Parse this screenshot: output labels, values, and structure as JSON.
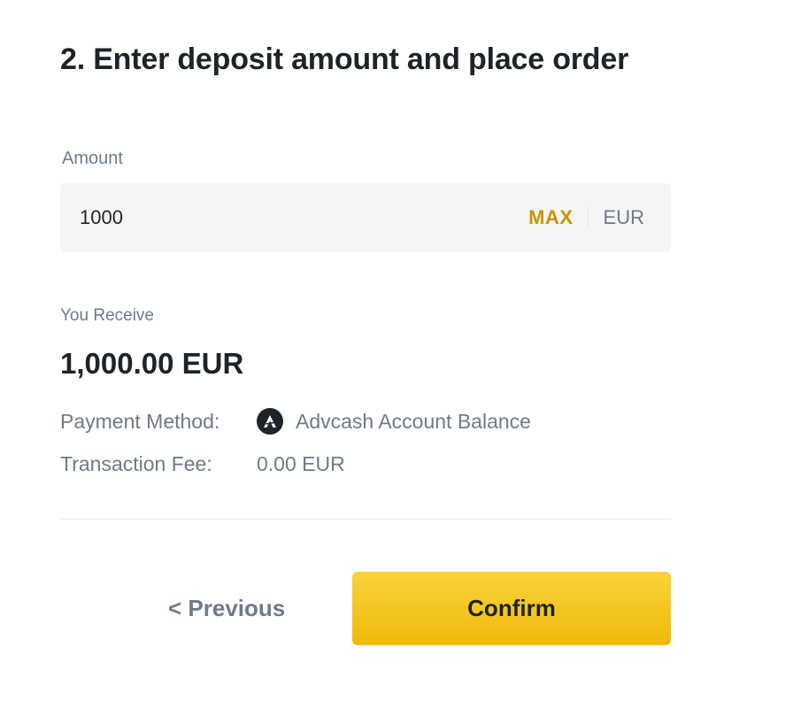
{
  "step": {
    "title": "2. Enter deposit amount and place order"
  },
  "amount": {
    "label": "Amount",
    "value": "1000",
    "max_label": "MAX",
    "currency": "EUR"
  },
  "receive": {
    "label": "You Receive",
    "value": "1,000.00 EUR"
  },
  "details": {
    "payment_method_label": "Payment Method:",
    "payment_method_icon": "advcash-logo-icon",
    "payment_method_value": "Advcash Account Balance",
    "fee_label": "Transaction Fee:",
    "fee_value": "0.00 EUR"
  },
  "actions": {
    "previous_label": "< Previous",
    "confirm_label": "Confirm"
  },
  "colors": {
    "accent_yellow": "#F0B90B",
    "max_gold": "#C99400",
    "text_primary": "#1E2329",
    "text_secondary": "#707A8A",
    "input_bg": "#F5F5F5"
  }
}
